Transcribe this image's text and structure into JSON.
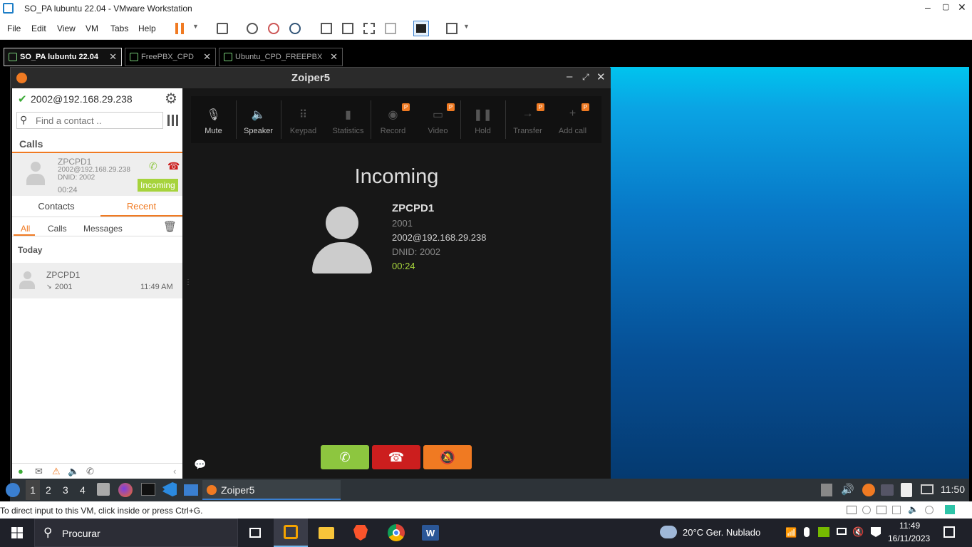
{
  "vmware": {
    "title": "SO_PA lubuntu 22.04 - VMware Workstation",
    "menu": [
      "File",
      "Edit",
      "View",
      "VM",
      "Tabs",
      "Help"
    ],
    "tabs": [
      {
        "label": "SO_PA lubuntu 22.04"
      },
      {
        "label": "FreePBX_CPD"
      },
      {
        "label": "Ubuntu_CPD_FREEPBX"
      }
    ],
    "status_text": "To direct input to this VM, click inside or press Ctrl+G."
  },
  "zoiper": {
    "window_title": "Zoiper5",
    "account": "2002@192.168.29.238",
    "search_placeholder": "Find a contact ..",
    "calls_heading": "Calls",
    "call_item": {
      "name": "ZPCPD1",
      "address": "2002@192.168.29.238",
      "dnid": "DNID: 2002",
      "timer": "00:24",
      "badge": "Incoming"
    },
    "tabs": [
      "Contacts",
      "Recent"
    ],
    "subtabs": [
      "All",
      "Calls",
      "Messages"
    ],
    "today_label": "Today",
    "recent_item": {
      "name": "ZPCPD1",
      "number": "2001",
      "time": "11:49 AM"
    },
    "toolbar": [
      {
        "label": "Mute",
        "icon": "mic-off-icon",
        "disabled": false,
        "premium": false
      },
      {
        "label": "Speaker",
        "icon": "speaker-icon",
        "disabled": false,
        "premium": false
      },
      {
        "label": "Keypad",
        "icon": "keypad-icon",
        "disabled": true,
        "premium": false
      },
      {
        "label": "Statistics",
        "icon": "statistics-icon",
        "disabled": true,
        "premium": false
      },
      {
        "label": "Record",
        "icon": "record-icon",
        "disabled": true,
        "premium": true
      },
      {
        "label": "Video",
        "icon": "video-icon",
        "disabled": true,
        "premium": true
      },
      {
        "label": "Hold",
        "icon": "pause-icon",
        "disabled": true,
        "premium": false
      },
      {
        "label": "Transfer",
        "icon": "transfer-icon",
        "disabled": true,
        "premium": true
      },
      {
        "label": "Add call",
        "icon": "add-icon",
        "disabled": true,
        "premium": true
      }
    ],
    "premium_badge": "P",
    "incoming": {
      "heading": "Incoming",
      "name": "ZPCPD1",
      "number": "2001",
      "address": "2002@192.168.29.238",
      "dnid": "DNID: 2002",
      "timer": "00:24"
    },
    "colors": {
      "accent": "#f07a22",
      "answer": "#8dc63f",
      "hangup": "#cc1e1e",
      "timer": "#a6d33c"
    }
  },
  "lxqt_panel": {
    "workspaces": [
      "1",
      "2",
      "3",
      "4"
    ],
    "task": "Zoiper5",
    "clock": "11:50"
  },
  "windows_taskbar": {
    "search": "Procurar",
    "weather": "20°C  Ger. Nublado",
    "time": "11:49",
    "date": "16/11/2023"
  }
}
